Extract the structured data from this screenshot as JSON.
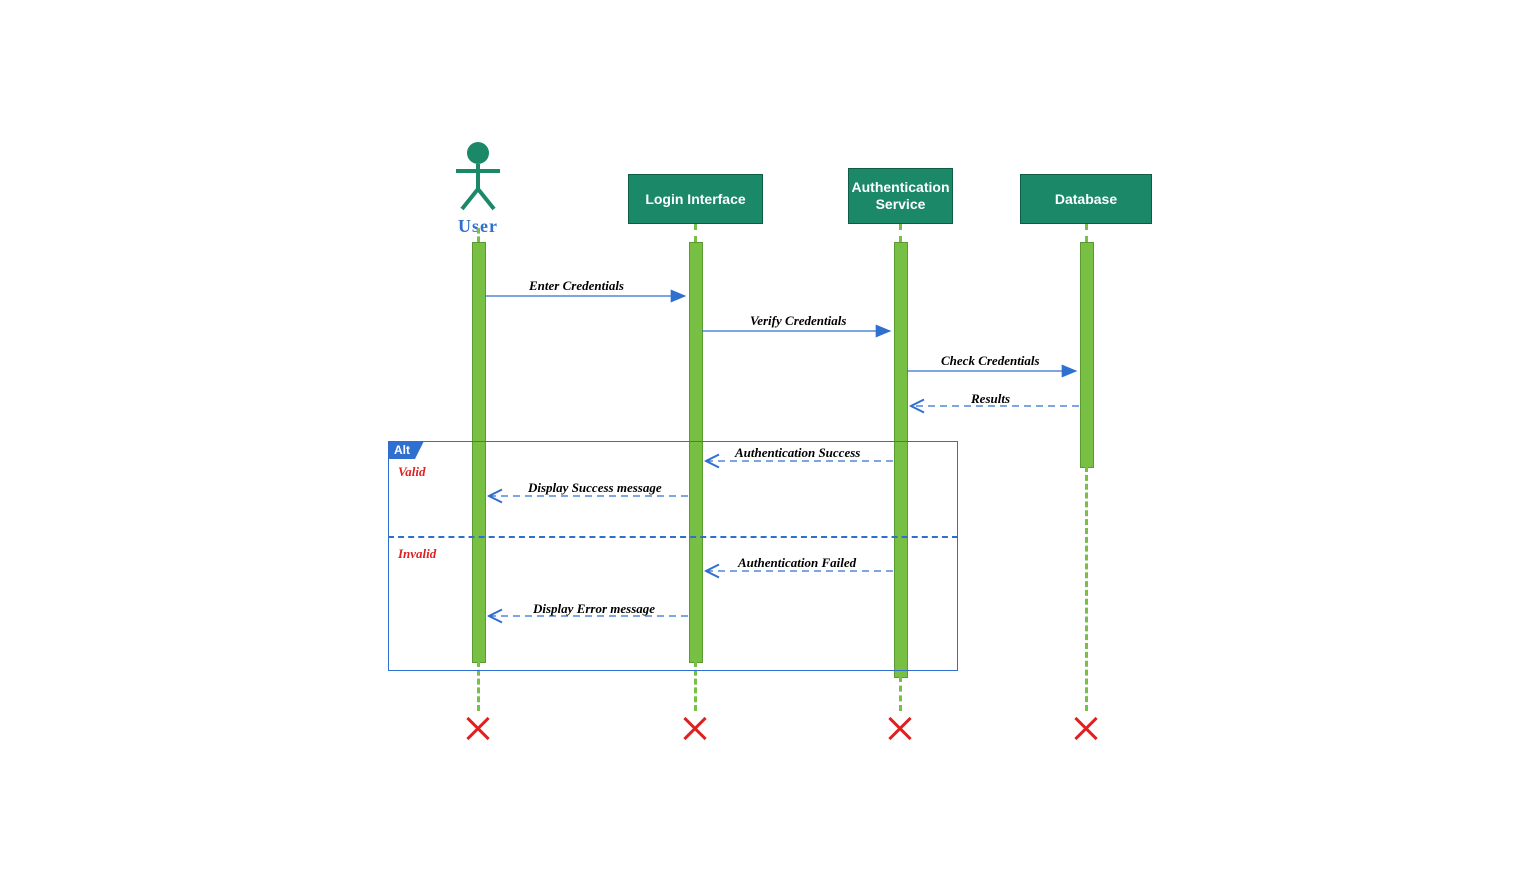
{
  "actors": {
    "user": "User",
    "login": "Login Interface",
    "auth": "Authentication Service",
    "db": "Database"
  },
  "messages": {
    "enter": "Enter Credentials",
    "verify": "Verify Credentials",
    "check": "Check Credentials",
    "results": "Results",
    "authSuccess": "Authentication Success",
    "dispSuccess": "Display Success message",
    "authFailed": "Authentication Failed",
    "dispError": "Display Error message"
  },
  "altLabel": "Alt",
  "guardValid": "Valid",
  "guardInvalid": "Invalid",
  "colors": {
    "box": "#1b8868",
    "bar": "#77c043",
    "blue": "#2f6fd0",
    "red": "#e02020"
  },
  "layout": {
    "xUser": 440,
    "xLogin": 657,
    "xAuth": 862,
    "xDb": 1048,
    "yHeaderTop": 148,
    "yHeaderBottom": 198,
    "yActTop": 216,
    "yActBottomUser": 635,
    "yActBottomLogin": 635,
    "yActBottomAuth": 650,
    "yActBottomDb": 440,
    "yLifelineEnd": 700,
    "yTerm": 700,
    "yMsgEnter": 270,
    "yMsgVerify": 305,
    "yMsgCheck": 345,
    "yMsgResults": 380,
    "altTop": 415,
    "altBottom": 645,
    "altLeft": 350,
    "altRight": 920,
    "altDivider": 510,
    "yAuthSuccess": 435,
    "yDispSuccess": 470,
    "yAuthFailed": 545,
    "yDispError": 590
  }
}
